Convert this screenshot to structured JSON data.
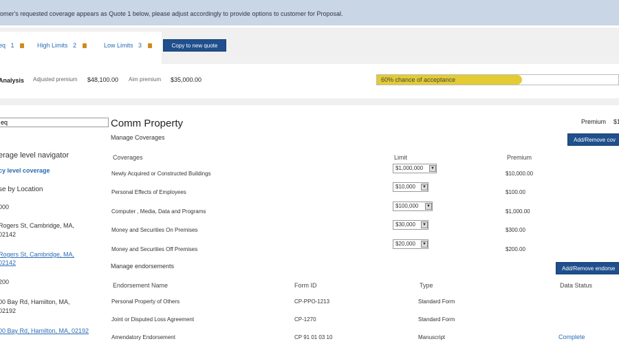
{
  "banner": {
    "text": "omer's requested coverage appears as Quote 1 below, please adjust accordingly to provide options to customer for Proposal."
  },
  "tabs": [
    {
      "label": "eq",
      "number": "1"
    },
    {
      "label": "High Limits",
      "number": "2"
    },
    {
      "label": "Low Limits",
      "number": "3"
    }
  ],
  "copy_button": "Copy to new quote",
  "analysis": {
    "title": "Analysis",
    "adjusted_label": "Adjusted premium",
    "adjusted_value": "$48,100.00",
    "aim_label": "Aim premium",
    "aim_value": "$35,000.00",
    "progress_text": "60% chance of acceptance",
    "progress_fraction": 0.6
  },
  "sidebar": {
    "search_value": "eq",
    "navigator_title": "erage level navigator",
    "policy_link": "cy level coverage",
    "browse_label": "se by Location",
    "loc1_code": "000",
    "loc1_address_line1": "Rogers St, Cambridge, MA,",
    "loc1_address_line2": "02142",
    "loc1_link_line1": "Rogers St, Cambridge, MA,",
    "loc1_link_line2": "02142",
    "loc2_code": "200",
    "loc2_address_line1": "00 Bay Rd, Hamilton, MA,",
    "loc2_address_line2": "02192",
    "loc2_link": "00 Bay Rd, Hamilton, MA, 02192"
  },
  "main": {
    "title": "Comm Property",
    "premium_label": "Premium",
    "premium_value": "$1",
    "manage_coverages": "Manage Coverages",
    "add_remove_coverages": "Add/Remove cov",
    "coverage_headers": {
      "coverages": "Coverages",
      "limit": "Limit",
      "premium": "Premium"
    },
    "coverages": [
      {
        "name": "Newly Acquired or Constructed Buildings",
        "limit": "$1,000,000",
        "premium": "$10,000.00"
      },
      {
        "name": "Personal Effects of Employees",
        "limit": "$10,000",
        "premium": "$100.00"
      },
      {
        "name": "Computer , Media, Data and Programs",
        "limit": "$100,000",
        "premium": "$1,000.00"
      },
      {
        "name": "Money and Securities On Premises",
        "limit": "$30,000",
        "premium": "$300.00"
      },
      {
        "name": "Money and Securities Off Premises",
        "limit": "$20,000",
        "premium": "$200.00"
      }
    ],
    "manage_endorsements": "Manage endorsements",
    "add_remove_endorsements": "Add/Remove endorse",
    "endorsement_headers": {
      "name": "Endorsement Name",
      "form": "Form ID",
      "type": "Type",
      "status": "Data Status"
    },
    "endorsements": [
      {
        "name": "Personal Property of Others",
        "form": "CP-PPO-1213",
        "type": "Standard Form",
        "status": ""
      },
      {
        "name": "Joint or Disputed Loss Agreement",
        "form": "CP-1270",
        "type": "Standard Form",
        "status": ""
      },
      {
        "name": "Amendatory Endorsement",
        "form": "CP 91 01 03 10",
        "type": "Manuscript",
        "status": "Complete"
      }
    ]
  },
  "colors": {
    "banner": "#c8d6e5",
    "accent": "#1f4f8c",
    "link": "#2a6cb5",
    "progress": "#e3cb34"
  }
}
